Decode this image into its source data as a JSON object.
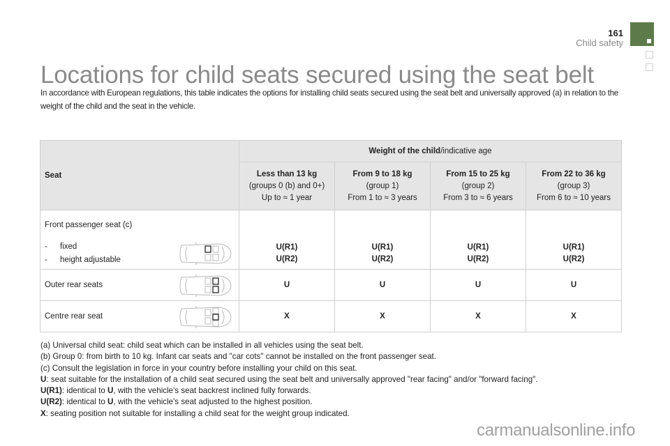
{
  "header": {
    "page_number": "161",
    "section": "Child safety",
    "accent_color": "#5d7a4a"
  },
  "title": "Locations for child seats secured using the seat belt",
  "intro": "In accordance with European regulations, this table indicates the options for installing child seats secured using the seat belt and universally approved (a) in relation to the weight of the child and the seat in the vehicle.",
  "table": {
    "seat_header": "Seat",
    "weight_header_bold": "Weight of the child",
    "weight_header_rest": "/indicative age",
    "columns": [
      {
        "weight": "Less than 13 kg",
        "group": "(groups 0 (b) and 0+)",
        "age": "Up to ≈ 1 year"
      },
      {
        "weight": "From 9 to 18 kg",
        "group": "(group 1)",
        "age": "From 1 to ≈ 3 years"
      },
      {
        "weight": "From 15 to 25 kg",
        "group": "(group 2)",
        "age": "From 3 to ≈ 6 years"
      },
      {
        "weight": "From 22 to 36 kg",
        "group": "(group 3)",
        "age": "From 6 to ≈ 10 years"
      }
    ],
    "rows": [
      {
        "seat": "Front passenger seat (c)",
        "sub_items": [
          {
            "dash": "-",
            "label": "fixed"
          },
          {
            "dash": "-",
            "label": "height adjustable"
          }
        ],
        "icon": "car-front-passenger-seat-icon",
        "values": [
          [
            "U(R1)",
            "U(R2)"
          ],
          [
            "U(R1)",
            "U(R2)"
          ],
          [
            "U(R1)",
            "U(R2)"
          ],
          [
            "U(R1)",
            "U(R2)"
          ]
        ]
      },
      {
        "seat": "Outer rear seats",
        "icon": "car-outer-rear-seats-icon",
        "values": [
          "U",
          "U",
          "U",
          "U"
        ]
      },
      {
        "seat": "Centre rear seat",
        "icon": "car-centre-rear-seat-icon",
        "values": [
          "X",
          "X",
          "X",
          "X"
        ]
      }
    ]
  },
  "legend": [
    {
      "key": "",
      "text": "(a) Universal child seat: child seat which can be installed in all vehicles using the seat belt."
    },
    {
      "key": "",
      "text": "(b) Group 0: from birth to 10 kg. Infant car seats and \"car cots\" cannot be installed on the front passenger seat."
    },
    {
      "key": "",
      "text": "(c) Consult the legislation in force in your country before installing your child on this seat."
    },
    {
      "key": "U",
      "text": ": seat suitable for the installation of a child seat secured using the seat belt and universally approved \"rear facing\" and/or \"forward facing\"."
    },
    {
      "key": "U(R1)",
      "text_a": ": identical to ",
      "key2": "U",
      "text": ", with the vehicle's seat backrest inclined fully forwards."
    },
    {
      "key": "U(R2)",
      "text_a": ": identical to ",
      "key2": "U",
      "text": ", with the vehicle's seat adjusted to the highest position."
    },
    {
      "key": "X",
      "text": ": seating position not suitable for installing a child seat for the weight group indicated."
    }
  ],
  "watermark": "carmanualsonline.info"
}
